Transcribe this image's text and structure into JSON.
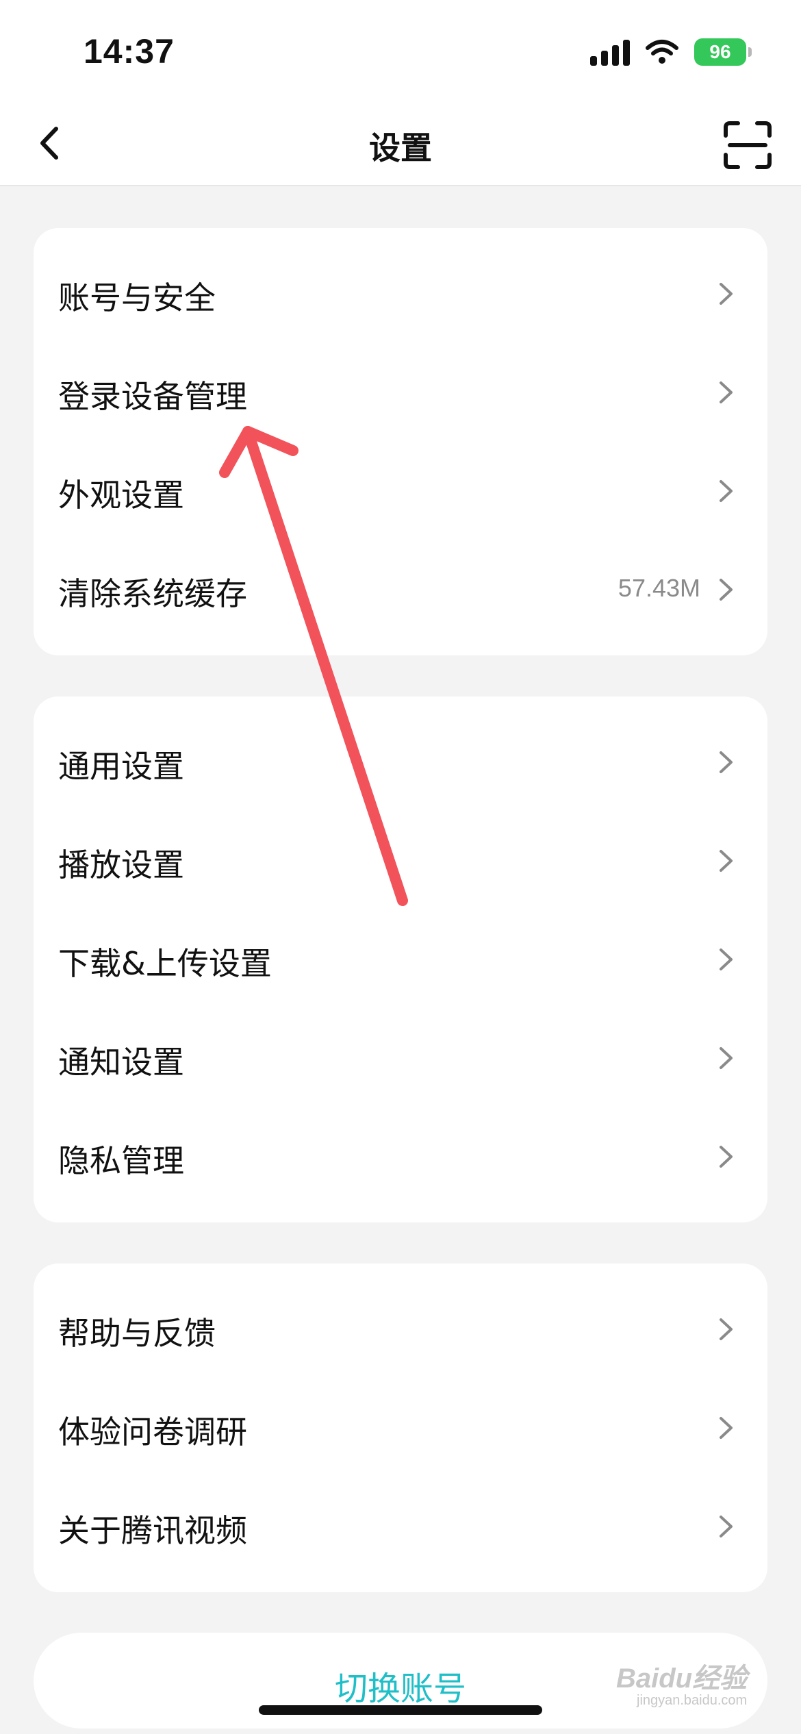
{
  "status_bar": {
    "time": "14:37",
    "battery": "96"
  },
  "nav": {
    "title": "设置",
    "back_icon": "chevron-left-icon",
    "scan_icon": "scan-icon"
  },
  "groups": [
    {
      "items": [
        {
          "label": "账号与安全",
          "value": ""
        },
        {
          "label": "登录设备管理",
          "value": ""
        },
        {
          "label": "外观设置",
          "value": ""
        },
        {
          "label": "清除系统缓存",
          "value": "57.43M"
        }
      ]
    },
    {
      "items": [
        {
          "label": "通用设置",
          "value": ""
        },
        {
          "label": "播放设置",
          "value": ""
        },
        {
          "label": "下载&上传设置",
          "value": ""
        },
        {
          "label": "通知设置",
          "value": ""
        },
        {
          "label": "隐私管理",
          "value": ""
        }
      ]
    },
    {
      "items": [
        {
          "label": "帮助与反馈",
          "value": ""
        },
        {
          "label": "体验问卷调研",
          "value": ""
        },
        {
          "label": "关于腾讯视频",
          "value": ""
        }
      ]
    }
  ],
  "switch_account": "切换账号",
  "watermark": {
    "brand": "Baidu经验",
    "url": "jingyan.baidu.com"
  },
  "colors": {
    "accent": "#20bfc8",
    "annotation_arrow": "#f2525a",
    "background": "#f3f3f3",
    "battery": "#34c759"
  }
}
